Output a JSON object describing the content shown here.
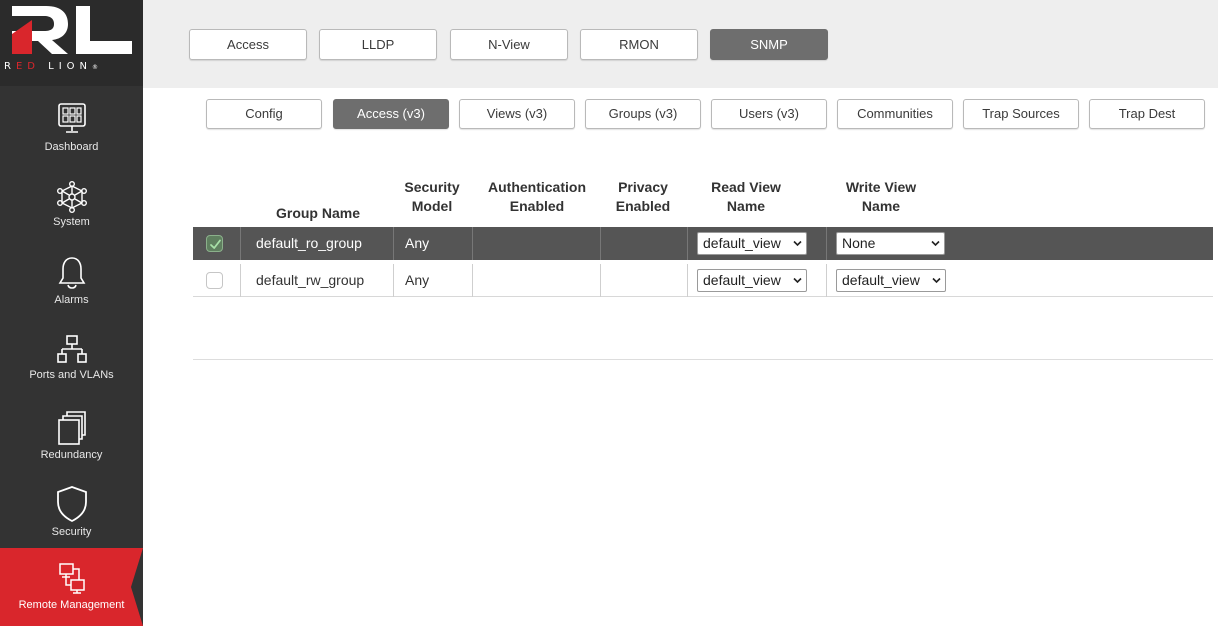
{
  "brand": {
    "logo_letters": "RL",
    "name_prefix": "R",
    "name_red_part": "ED ",
    "name_suffix": "LION",
    "name_mark": "®",
    "colors": {
      "red": "#d9262c",
      "sidebar": "#333333",
      "active_nav": "#d9262c",
      "active_tab": "#6e6e6e"
    }
  },
  "sidebar": {
    "items": [
      {
        "label": "Dashboard",
        "icon": "dashboard-icon"
      },
      {
        "label": "System",
        "icon": "network-nodes-icon"
      },
      {
        "label": "Alarms",
        "icon": "bell-icon"
      },
      {
        "label": "Ports and VLANs",
        "icon": "ports-icon"
      },
      {
        "label": "Redundancy",
        "icon": "stacked-windows-icon"
      },
      {
        "label": "Security",
        "icon": "shield-icon"
      },
      {
        "label": "Remote Management",
        "icon": "remote-management-icon",
        "active": true
      }
    ]
  },
  "top_tabs": [
    {
      "label": "Access"
    },
    {
      "label": "LLDP"
    },
    {
      "label": "N-View"
    },
    {
      "label": "RMON"
    },
    {
      "label": "SNMP",
      "active": true
    }
  ],
  "sub_tabs": [
    {
      "label": "Config"
    },
    {
      "label": "Access (v3)",
      "active": true
    },
    {
      "label": "Views (v3)"
    },
    {
      "label": "Groups (v3)"
    },
    {
      "label": "Users (v3)"
    },
    {
      "label": "Communities"
    },
    {
      "label": "Trap Sources"
    },
    {
      "label": "Trap Dest"
    }
  ],
  "table": {
    "headers": {
      "group_name": "Group Name",
      "security_model_1": "Security",
      "security_model_2": "Model",
      "auth_1": "Authentication",
      "auth_2": "Enabled",
      "privacy_1": "Privacy",
      "privacy_2": "Enabled",
      "read_view_1": "Read View",
      "read_view_2": "Name",
      "write_view_1": "Write View",
      "write_view_2": "Name"
    },
    "rows": [
      {
        "checked": true,
        "group_name": "default_ro_group",
        "security_model": "Any",
        "authentication": "",
        "privacy": "",
        "read_view": "default_view",
        "write_view": "None"
      },
      {
        "checked": false,
        "group_name": "default_rw_group",
        "security_model": "Any",
        "authentication": "",
        "privacy": "",
        "read_view": "default_view",
        "write_view": "default_view"
      }
    ]
  }
}
